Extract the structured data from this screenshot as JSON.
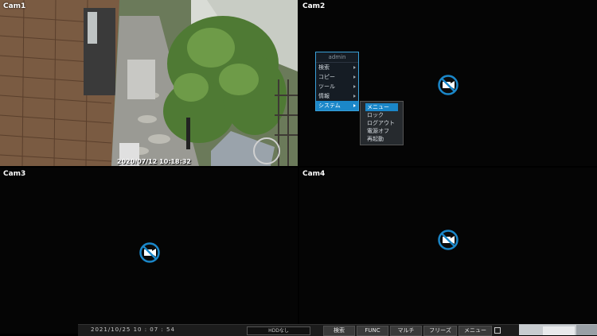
{
  "cameras": [
    {
      "label": "Cam1",
      "timestamp": "2020/07/12 10:18:32"
    },
    {
      "label": "Cam2"
    },
    {
      "label": "Cam3"
    },
    {
      "label": "Cam4"
    }
  ],
  "icons": {
    "no_signal": "camera-off-icon",
    "accent": "#1b87c9"
  },
  "menu": {
    "title": "admin",
    "items": [
      {
        "label": "検索",
        "has_submenu": true
      },
      {
        "label": "コピー",
        "has_submenu": true
      },
      {
        "label": "ツール",
        "has_submenu": true
      },
      {
        "label": "情報",
        "has_submenu": true
      },
      {
        "label": "システム",
        "has_submenu": true,
        "active": true
      }
    ],
    "submenu": [
      {
        "label": "メニュー",
        "active": true
      },
      {
        "label": "ロック"
      },
      {
        "label": "ログアウト"
      },
      {
        "label": "電源オフ"
      },
      {
        "label": "再起動"
      }
    ]
  },
  "statusbar": {
    "datetime": "2021/10/25  10 : 07 : 54",
    "hdd": "HDDなし",
    "buttons": [
      "検索",
      "FUNC",
      "マルチ",
      "フリーズ",
      "メニュー"
    ]
  }
}
